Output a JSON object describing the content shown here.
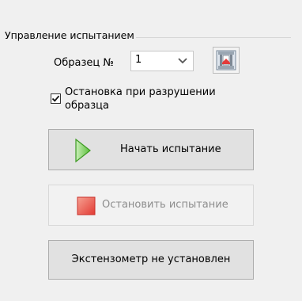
{
  "group": {
    "title": "Управление испытанием"
  },
  "sample": {
    "label": "Образец №",
    "selected": "1"
  },
  "checkbox": {
    "label": "Остановка при разрушении образца",
    "checked": true
  },
  "buttons": {
    "start_label": "Начать испытание",
    "stop_label": "Остановить испытание",
    "extensometer_label": "Экстензометр не установлен"
  },
  "icons": {
    "select_arrow": "chevron-down-icon",
    "fixture": "grip-fixture-icon",
    "start": "play-icon",
    "stop": "stop-square-icon"
  },
  "colors": {
    "play_green": "#5bbf3a",
    "stop_red": "#e8524a",
    "disabled_text": "#8d8d8d"
  }
}
